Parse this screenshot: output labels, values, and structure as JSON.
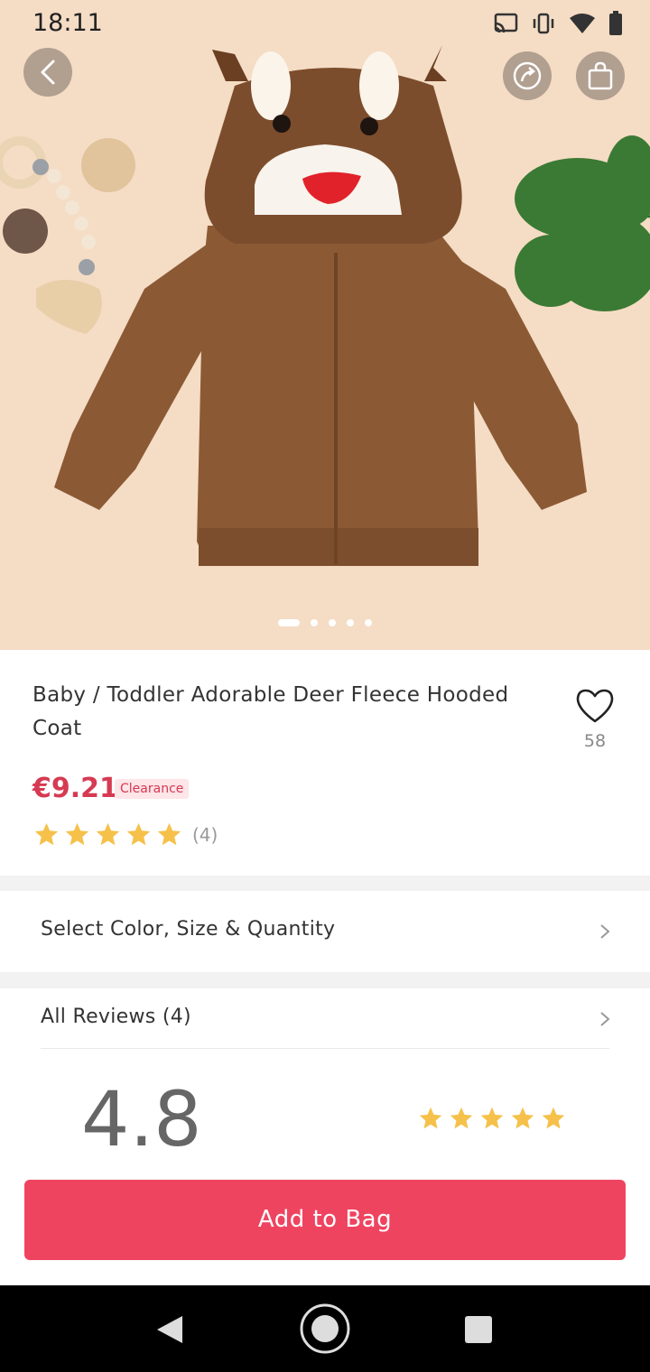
{
  "status_bar": {
    "time": "18:11"
  },
  "product": {
    "title": "Baby / Toddler Adorable Deer Fleece Hooded Coat",
    "price": "€9.21",
    "badge": "Clearance",
    "rating_stars": 5,
    "rating_count": "(4)",
    "favorite_count": "58",
    "image_count": 5,
    "active_image_index": 0
  },
  "options_row": {
    "label": "Select Color, Size & Quantity"
  },
  "reviews": {
    "label": "All Reviews (4)",
    "score": "4.8",
    "stars": 5
  },
  "cta": {
    "label": "Add to Bag"
  },
  "colors": {
    "accent": "#ef4460",
    "price": "#d63a52",
    "star": "#f6c14a",
    "hero_bg": "#f5dcc5"
  }
}
